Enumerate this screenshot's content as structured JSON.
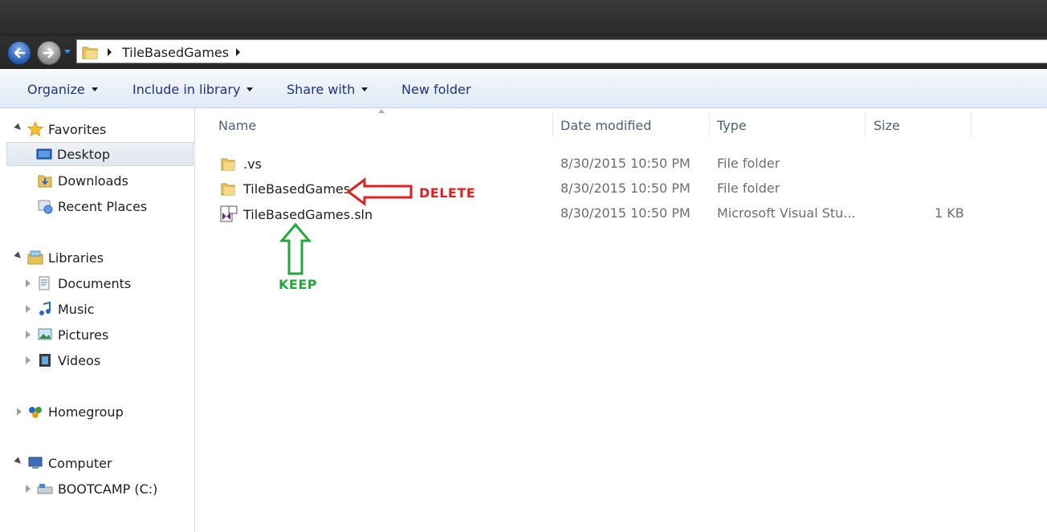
{
  "address": {
    "segments": [
      "TileBasedGames"
    ]
  },
  "commands": {
    "organize": "Organize",
    "include_in_library": "Include in library",
    "share_with": "Share with",
    "new_folder": "New folder"
  },
  "nav": {
    "favorites": "Favorites",
    "desktop": "Desktop",
    "downloads": "Downloads",
    "recent_places": "Recent Places",
    "libraries": "Libraries",
    "documents": "Documents",
    "music": "Music",
    "pictures": "Pictures",
    "videos": "Videos",
    "homegroup": "Homegroup",
    "computer": "Computer",
    "bootcamp": "BOOTCAMP (C:)"
  },
  "columns": {
    "name": "Name",
    "date_modified": "Date modified",
    "type": "Type",
    "size": "Size"
  },
  "files": [
    {
      "name": ".vs",
      "date": "8/30/2015 10:50 PM",
      "type": "File folder",
      "size": "",
      "icon": "folder-icon"
    },
    {
      "name": "TileBasedGames",
      "date": "8/30/2015 10:50 PM",
      "type": "File folder",
      "size": "",
      "icon": "folder-icon"
    },
    {
      "name": "TileBasedGames.sln",
      "date": "8/30/2015 10:50 PM",
      "type": "Microsoft Visual Stu...",
      "size": "1 KB",
      "icon": "visual-studio-solution-icon"
    }
  ],
  "annotations": {
    "delete_label": "DELETE",
    "keep_label": "KEEP",
    "delete_color": "#e02020",
    "keep_color": "#22a83a"
  },
  "colors": {
    "command_text": "#1e3287",
    "folder": "#e8c35a"
  }
}
